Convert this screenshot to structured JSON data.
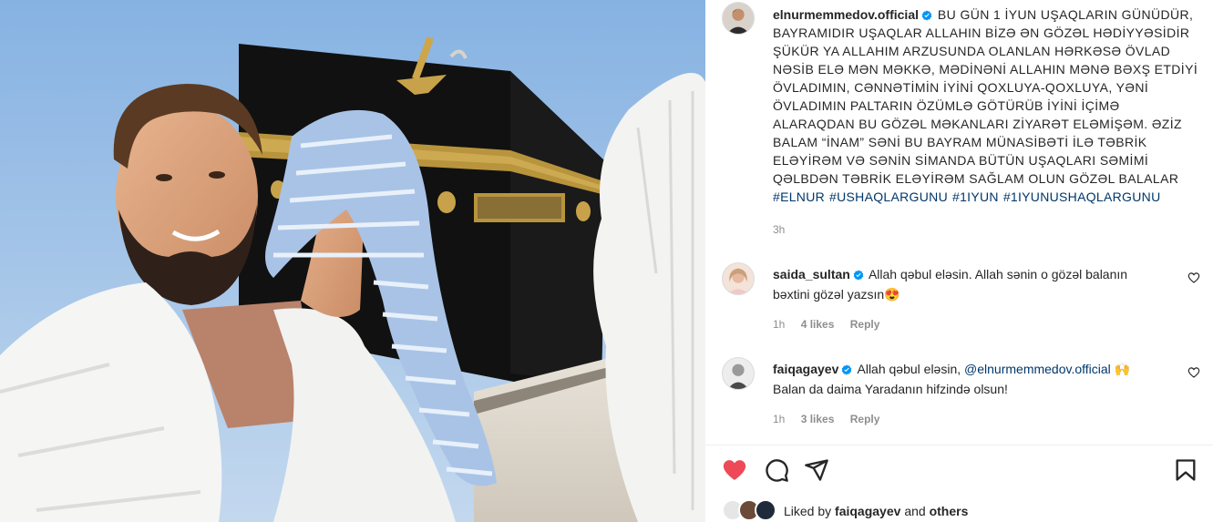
{
  "post": {
    "username": "elnurmemmedov.official",
    "caption": "BU GÜN 1 İYUN UŞAQLARIN GÜNÜDÜR, BAYRAMIDIR UŞAQLAR ALLAHIN BİZƏ ƏN GÖZƏL HƏDİYYƏSİDİR ŞÜKÜR YA ALLAHIM ARZUSUNDA OLANLAN HƏRKƏSƏ ÖVLAD NƏSİB ELƏ MƏN MƏKKƏ, MƏDİNƏNİ ALLAHIN MƏNƏ BƏXŞ ETDİYİ ÖVLADIMIN, CƏNNƏTİMİN İYİNİ QOXLUYA-QOXLUYA, YƏNİ ÖVLADIMIN PALTARIN ÖZÜMLƏ GÖTÜRÜB İYİNİ İÇİMƏ ALARAQDAN BU GÖZƏL MƏKANLARI ZİYARƏT ELƏMİŞƏM. ƏZİZ BALAM “İNAM” SƏNİ BU BAYRAM MÜNASİBƏTİ İLƏ TƏBRİK ELƏYİRƏM VƏ SƏNİN SİMANDA BÜTÜN UŞAQLARI SƏMİMİ QƏLBDƏN TƏBRİK ELƏYİRƏM SAĞLAM OLUN GÖZƏL BALALAR",
    "hashtags": [
      "#ELNUR",
      "#USHAQLARGUNU",
      "#1IYUN",
      "#1IYUNUSHAQLARGUNU"
    ],
    "time": "3h"
  },
  "comments": [
    {
      "username": "saida_sultan",
      "text": "Allah qəbul eləsin. Allah sənin o gözəl balanın bəxtini gözəl yazsın",
      "emoji": "😍",
      "time": "1h",
      "likes": "4 likes",
      "reply": "Reply"
    },
    {
      "username": "faiqagayev",
      "text_before": "Allah qəbul eləsin, ",
      "mention": "@elnurmemmedov.official",
      "emoji": "🙌",
      "text_after": "Balan da daima Yaradanın hifzində olsun!",
      "time": "1h",
      "likes": "3 likes",
      "reply": "Reply"
    }
  ],
  "likes": {
    "prefix": "Liked by",
    "user": "faiqagayev",
    "joiner": "and",
    "others": "others"
  },
  "icons": {
    "like": "heart-icon",
    "comment": "comment-icon",
    "share": "share-icon",
    "save": "bookmark-icon",
    "verified": "verified-badge-icon",
    "comment_like": "heart-outline-icon"
  },
  "colors": {
    "liked_heart": "#ed4956",
    "verified": "#0095f6",
    "link": "#00376b",
    "muted": "#8e8e8e"
  }
}
